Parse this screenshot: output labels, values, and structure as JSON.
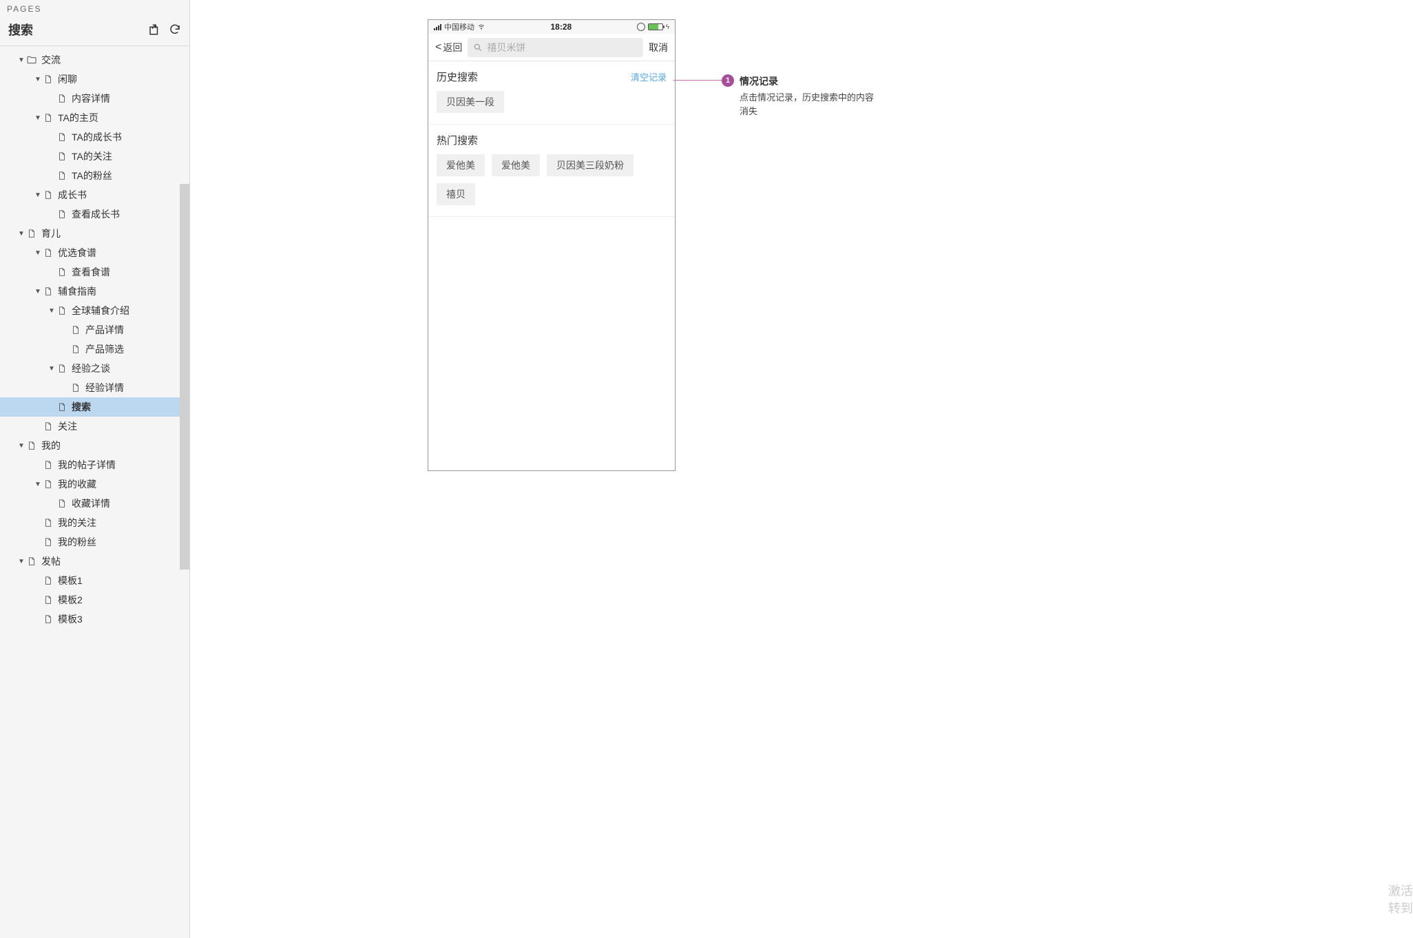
{
  "sidebar": {
    "header_label": "PAGES",
    "title": "搜索",
    "tree": [
      {
        "depth": 0,
        "caret": "down",
        "icon": "folder",
        "label": "交流"
      },
      {
        "depth": 1,
        "caret": "down",
        "icon": "page",
        "label": "闲聊"
      },
      {
        "depth": 2,
        "caret": "none",
        "icon": "page",
        "label": "内容详情"
      },
      {
        "depth": 1,
        "caret": "down",
        "icon": "page",
        "label": "TA的主页"
      },
      {
        "depth": 2,
        "caret": "none",
        "icon": "page",
        "label": "TA的成长书"
      },
      {
        "depth": 2,
        "caret": "none",
        "icon": "page",
        "label": "TA的关注"
      },
      {
        "depth": 2,
        "caret": "none",
        "icon": "page",
        "label": "TA的粉丝"
      },
      {
        "depth": 1,
        "caret": "down",
        "icon": "page",
        "label": "成长书"
      },
      {
        "depth": 2,
        "caret": "none",
        "icon": "page",
        "label": "查看成长书"
      },
      {
        "depth": 0,
        "caret": "down",
        "icon": "page",
        "label": "育儿"
      },
      {
        "depth": 1,
        "caret": "down",
        "icon": "page",
        "label": "优选食谱"
      },
      {
        "depth": 2,
        "caret": "none",
        "icon": "page",
        "label": "查看食谱"
      },
      {
        "depth": 1,
        "caret": "down",
        "icon": "page",
        "label": "辅食指南"
      },
      {
        "depth": 2,
        "caret": "down",
        "icon": "page",
        "label": "全球辅食介绍"
      },
      {
        "depth": 3,
        "caret": "none",
        "icon": "page",
        "label": "产品详情"
      },
      {
        "depth": 3,
        "caret": "none",
        "icon": "page",
        "label": "产品筛选"
      },
      {
        "depth": 2,
        "caret": "down",
        "icon": "page",
        "label": "经验之谈"
      },
      {
        "depth": 3,
        "caret": "none",
        "icon": "page",
        "label": "经验详情"
      },
      {
        "depth": 2,
        "caret": "none",
        "icon": "page",
        "label": "搜索",
        "selected": true
      },
      {
        "depth": 1,
        "caret": "none",
        "icon": "page",
        "label": "关注"
      },
      {
        "depth": 0,
        "caret": "down",
        "icon": "page",
        "label": "我的"
      },
      {
        "depth": 1,
        "caret": "none",
        "icon": "page",
        "label": "我的帖子详情"
      },
      {
        "depth": 1,
        "caret": "down",
        "icon": "page",
        "label": "我的收藏"
      },
      {
        "depth": 2,
        "caret": "none",
        "icon": "page",
        "label": "收藏详情"
      },
      {
        "depth": 1,
        "caret": "none",
        "icon": "page",
        "label": "我的关注"
      },
      {
        "depth": 1,
        "caret": "none",
        "icon": "page",
        "label": "我的粉丝"
      },
      {
        "depth": 0,
        "caret": "down",
        "icon": "page",
        "label": "发帖"
      },
      {
        "depth": 1,
        "caret": "none",
        "icon": "page",
        "label": "模板1"
      },
      {
        "depth": 1,
        "caret": "none",
        "icon": "page",
        "label": "模板2"
      },
      {
        "depth": 1,
        "caret": "none",
        "icon": "page",
        "label": "模板3"
      }
    ]
  },
  "phone": {
    "status": {
      "carrier": "中国移动",
      "time": "18:28"
    },
    "nav": {
      "back": "返回",
      "placeholder": "禧贝米饼",
      "cancel": "取消"
    },
    "history": {
      "title": "历史搜索",
      "clear": "清空记录",
      "tags": [
        "贝因美一段"
      ]
    },
    "hot": {
      "title": "热门搜索",
      "tags": [
        "爱他美",
        "爱他美",
        "贝因美三段奶粉",
        "禧贝"
      ]
    }
  },
  "annotation": {
    "num": "1",
    "title": "情况记录",
    "desc": "点击情况记录，历史搜索中的内容消失"
  },
  "watermark": {
    "line1": "激活",
    "line2": "转到"
  }
}
